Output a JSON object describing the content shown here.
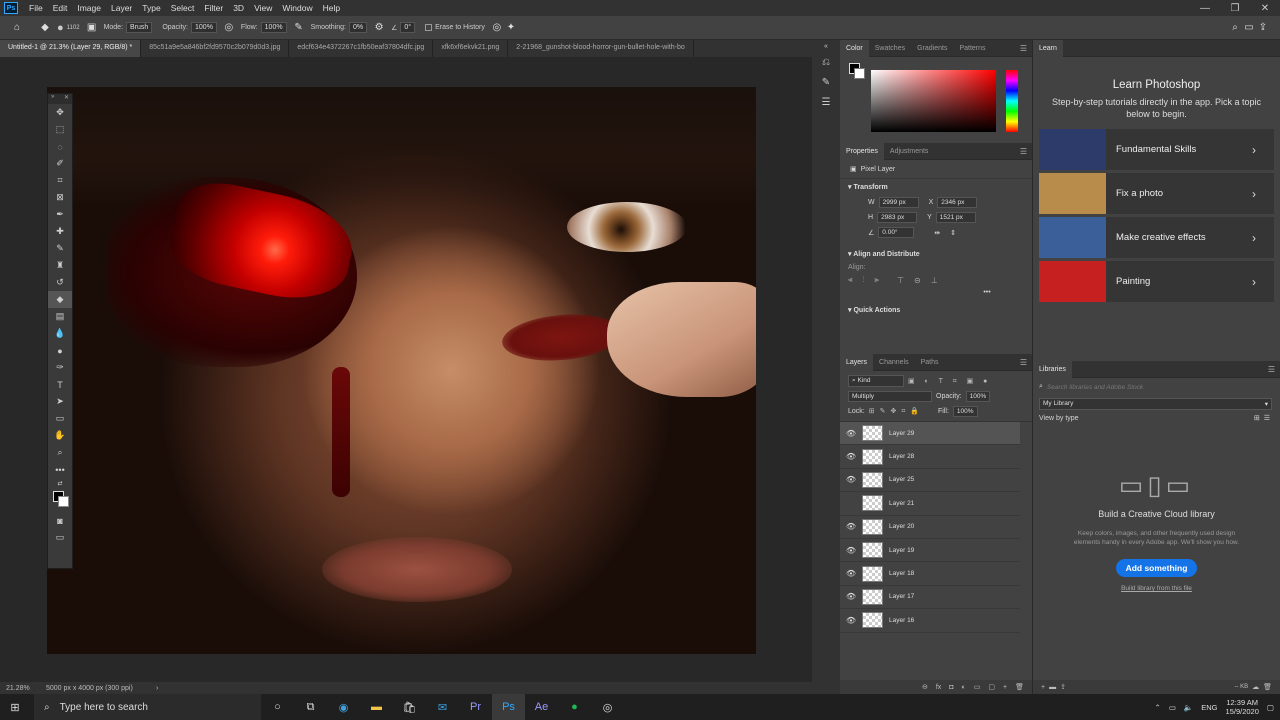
{
  "app": {
    "logo": "Ps",
    "menu": [
      "File",
      "Edit",
      "Image",
      "Layer",
      "Type",
      "Select",
      "Filter",
      "3D",
      "View",
      "Window",
      "Help"
    ],
    "window_controls": [
      "—",
      "❐",
      "✕"
    ]
  },
  "options": {
    "brush_size": "1102",
    "mode_label": "Mode:",
    "mode_value": "Brush",
    "opacity_label": "Opacity:",
    "opacity_value": "100%",
    "flow_label": "Flow:",
    "flow_value": "100%",
    "smoothing_label": "Smoothing:",
    "smoothing_value": "0%",
    "angle_value": "0°",
    "erase_history": "Erase to History"
  },
  "tabs": [
    "Untitled-1 @ 21.3% (Layer 29, RGB/8) *",
    "85c51a9e5a846bf2fd9570c2b079d0d3.jpg",
    "edcf634e4372267c1fb50eaf37804dfc.jpg",
    "xfk6xf6ekvk21.png",
    "2-21968_gunshot-blood-horror-gun-bullet-hole-with-bo"
  ],
  "status": {
    "zoom": "21.28%",
    "doc": "5000 px x 4000 px (300 ppi)",
    "arrow": "›"
  },
  "color_panel": {
    "tabs": [
      "Color",
      "Swatches",
      "Gradients",
      "Patterns"
    ]
  },
  "properties": {
    "tabs": [
      "Properties",
      "Adjustments"
    ],
    "kind": "Pixel Layer",
    "transform": "Transform",
    "w_label": "W",
    "w": "2999 px",
    "x_label": "X",
    "x": "2346 px",
    "h_label": "H",
    "h": "2983 px",
    "y_label": "Y",
    "y": "1521 px",
    "angle": "0.00°",
    "align": "Align and Distribute",
    "align_label": "Align:",
    "quick": "Quick Actions",
    "more": "•••"
  },
  "layers_panel": {
    "tabs": [
      "Layers",
      "Channels",
      "Paths"
    ],
    "filter": "Kind",
    "blend": "Multiply",
    "opacity_label": "Opacity:",
    "opacity": "100%",
    "lock_label": "Lock:",
    "fill_label": "Fill:",
    "fill": "100%",
    "layers": [
      {
        "name": "Layer 29",
        "visible": true,
        "selected": true
      },
      {
        "name": "Layer 28",
        "visible": true
      },
      {
        "name": "Layer 25",
        "visible": true
      },
      {
        "name": "Layer 21",
        "visible": false
      },
      {
        "name": "Layer 20",
        "visible": true
      },
      {
        "name": "Layer 19",
        "visible": true
      },
      {
        "name": "Layer 18",
        "visible": true
      },
      {
        "name": "Layer 17",
        "visible": true
      },
      {
        "name": "Layer 16",
        "visible": true
      }
    ],
    "footer": [
      "⊖",
      "fx",
      "◘",
      "◐",
      "▭",
      "▢",
      "+",
      "🗑"
    ]
  },
  "learn": {
    "tab": "Learn",
    "title": "Learn Photoshop",
    "subtitle": "Step-by-step tutorials directly in the app. Pick a topic below to begin.",
    "cards": [
      {
        "label": "Fundamental Skills",
        "color": "#2c3b6a"
      },
      {
        "label": "Fix a photo",
        "color": "#b88c4a"
      },
      {
        "label": "Make creative effects",
        "color": "#3a5f99"
      },
      {
        "label": "Painting",
        "color": "#c62020"
      }
    ]
  },
  "libraries": {
    "tab": "Libraries",
    "search_placeholder": "Search libraries and Adobe Stock",
    "library": "My Library",
    "view": "View by type",
    "title": "Build a Creative Cloud library",
    "desc": "Keep colors, images, and other frequently used design elements handy in every Adobe app. We'll show you how.",
    "button": "Add something",
    "link": "Build library from this file",
    "size": "-- KB"
  },
  "taskbar": {
    "search": "Type here to search",
    "lang": "ENG",
    "time": "12:39 AM",
    "date": "15/9/2020"
  }
}
